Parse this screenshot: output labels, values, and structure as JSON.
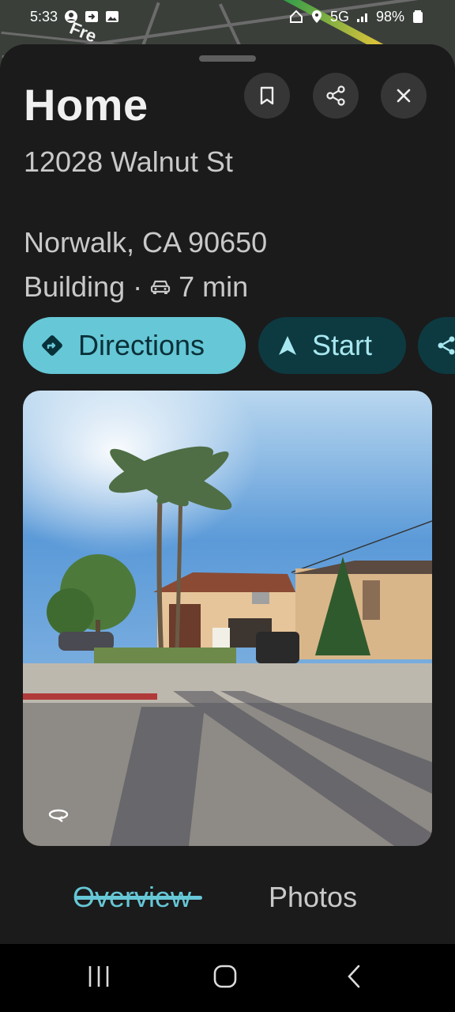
{
  "status_bar": {
    "time": "5:33",
    "network": "5G",
    "battery": "98%"
  },
  "map_label": "Fre",
  "place": {
    "title": "Home",
    "address_line1": "12028 Walnut St",
    "address_line2": "Norwalk, CA 90650",
    "category": "Building",
    "separator": "·",
    "drive_time": "7 min"
  },
  "actions": {
    "directions_label": "Directions",
    "start_label": "Start"
  },
  "tabs": [
    {
      "label": "Overview",
      "selected": true
    },
    {
      "label": "Photos",
      "selected": false
    }
  ],
  "colors": {
    "accent": "#66c7d6",
    "chip_dark": "#0d3a41",
    "sheet_bg": "#1b1b1b"
  }
}
